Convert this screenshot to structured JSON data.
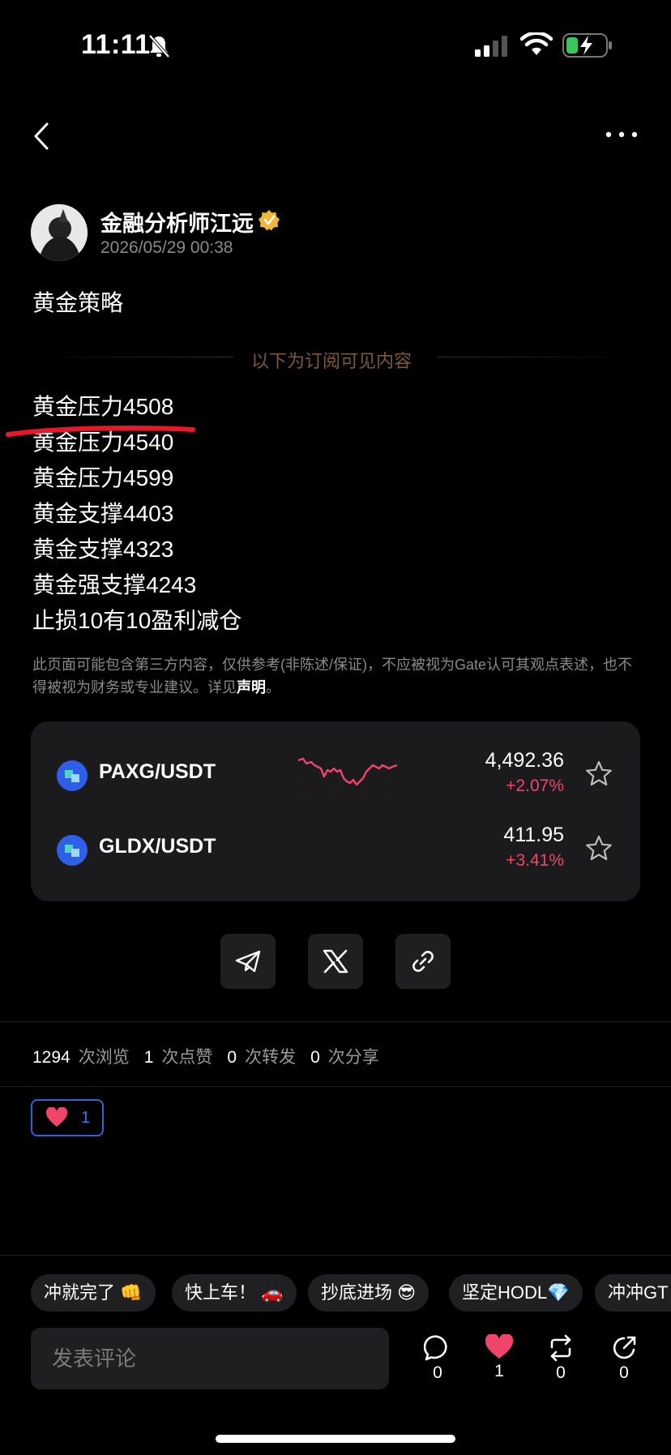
{
  "status_bar": {
    "time": "11:11"
  },
  "author": {
    "name": "金融分析师江远",
    "time": "2026/05/29 00:38"
  },
  "post": {
    "title": "黄金策略",
    "subscriber_divider": "以下为订阅可见内容",
    "lines": [
      "黄金压力4508",
      "黄金压力4540",
      "黄金压力4599",
      "黄金支撑4403",
      "黄金支撑4323",
      "黄金强支撑4243",
      "止损10有10盈利减仓"
    ]
  },
  "disclaimer": {
    "text": "此页面可能包含第三方内容，仅供参考(非陈述/保证)，不应被视为Gate认可其观点表述，也不得被视为财务或专业建议。详见",
    "link": "声明",
    "end": "。"
  },
  "markets": [
    {
      "pair": "PAXG/USDT",
      "price": "4,492.36",
      "change": "+2.07%",
      "has_chart": true
    },
    {
      "pair": "GLDX/USDT",
      "price": "411.95",
      "change": "+3.41%",
      "has_chart": false
    }
  ],
  "share_buttons": [
    "telegram-icon",
    "x-icon",
    "link-icon"
  ],
  "stats": {
    "views": "1294",
    "views_label": "次浏览",
    "likes": "1",
    "likes_label": "次点赞",
    "reposts": "0",
    "reposts_label": "次转发",
    "shares": "0",
    "shares_label": "次分享"
  },
  "reaction": {
    "icon": "heart",
    "count": "1"
  },
  "quick_replies": [
    "冲就完了 👊",
    "快上车！ 🚗",
    "抄底进场 😎",
    "坚定HODL💎",
    "冲冲GT"
  ],
  "comment": {
    "placeholder": "发表评论"
  },
  "actions": {
    "comments": "0",
    "likes": "1",
    "reposts": "0",
    "shares": "0"
  },
  "colors": {
    "accent_red": "#f0456a",
    "accent_blue": "#2f63d6",
    "divider_gold": "#7a5a38"
  }
}
